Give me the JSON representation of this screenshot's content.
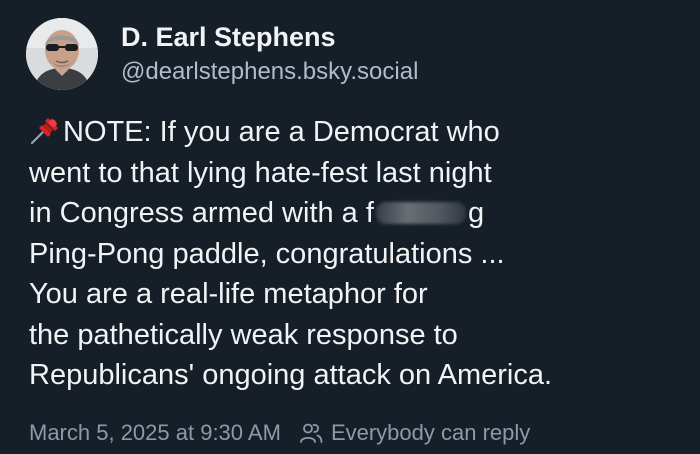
{
  "author": {
    "name": "D. Earl Stephens",
    "handle": "@dearlstephens.bsky.social",
    "avatar_icon": "profile-photo"
  },
  "post": {
    "lines": [
      "NOTE: If you are a Democrat who",
      "went to that lying hate-fest last night",
      "in Congress armed with a f",
      "g",
      "Ping-Pong paddle, congratulations ...",
      "You are a real-life metaphor for",
      "the pathetically weak response to",
      "Republicans' ongoing attack on America."
    ],
    "leading_icon": "pushpin-icon"
  },
  "meta": {
    "timestamp": "March 5, 2025 at 9:30 AM",
    "audience": "Everybody can reply",
    "audience_icon": "people-icon"
  },
  "colors": {
    "background": "#161e27",
    "text": "#f1f3f5",
    "handle": "#aebbc9",
    "meta": "#8b9aab"
  }
}
